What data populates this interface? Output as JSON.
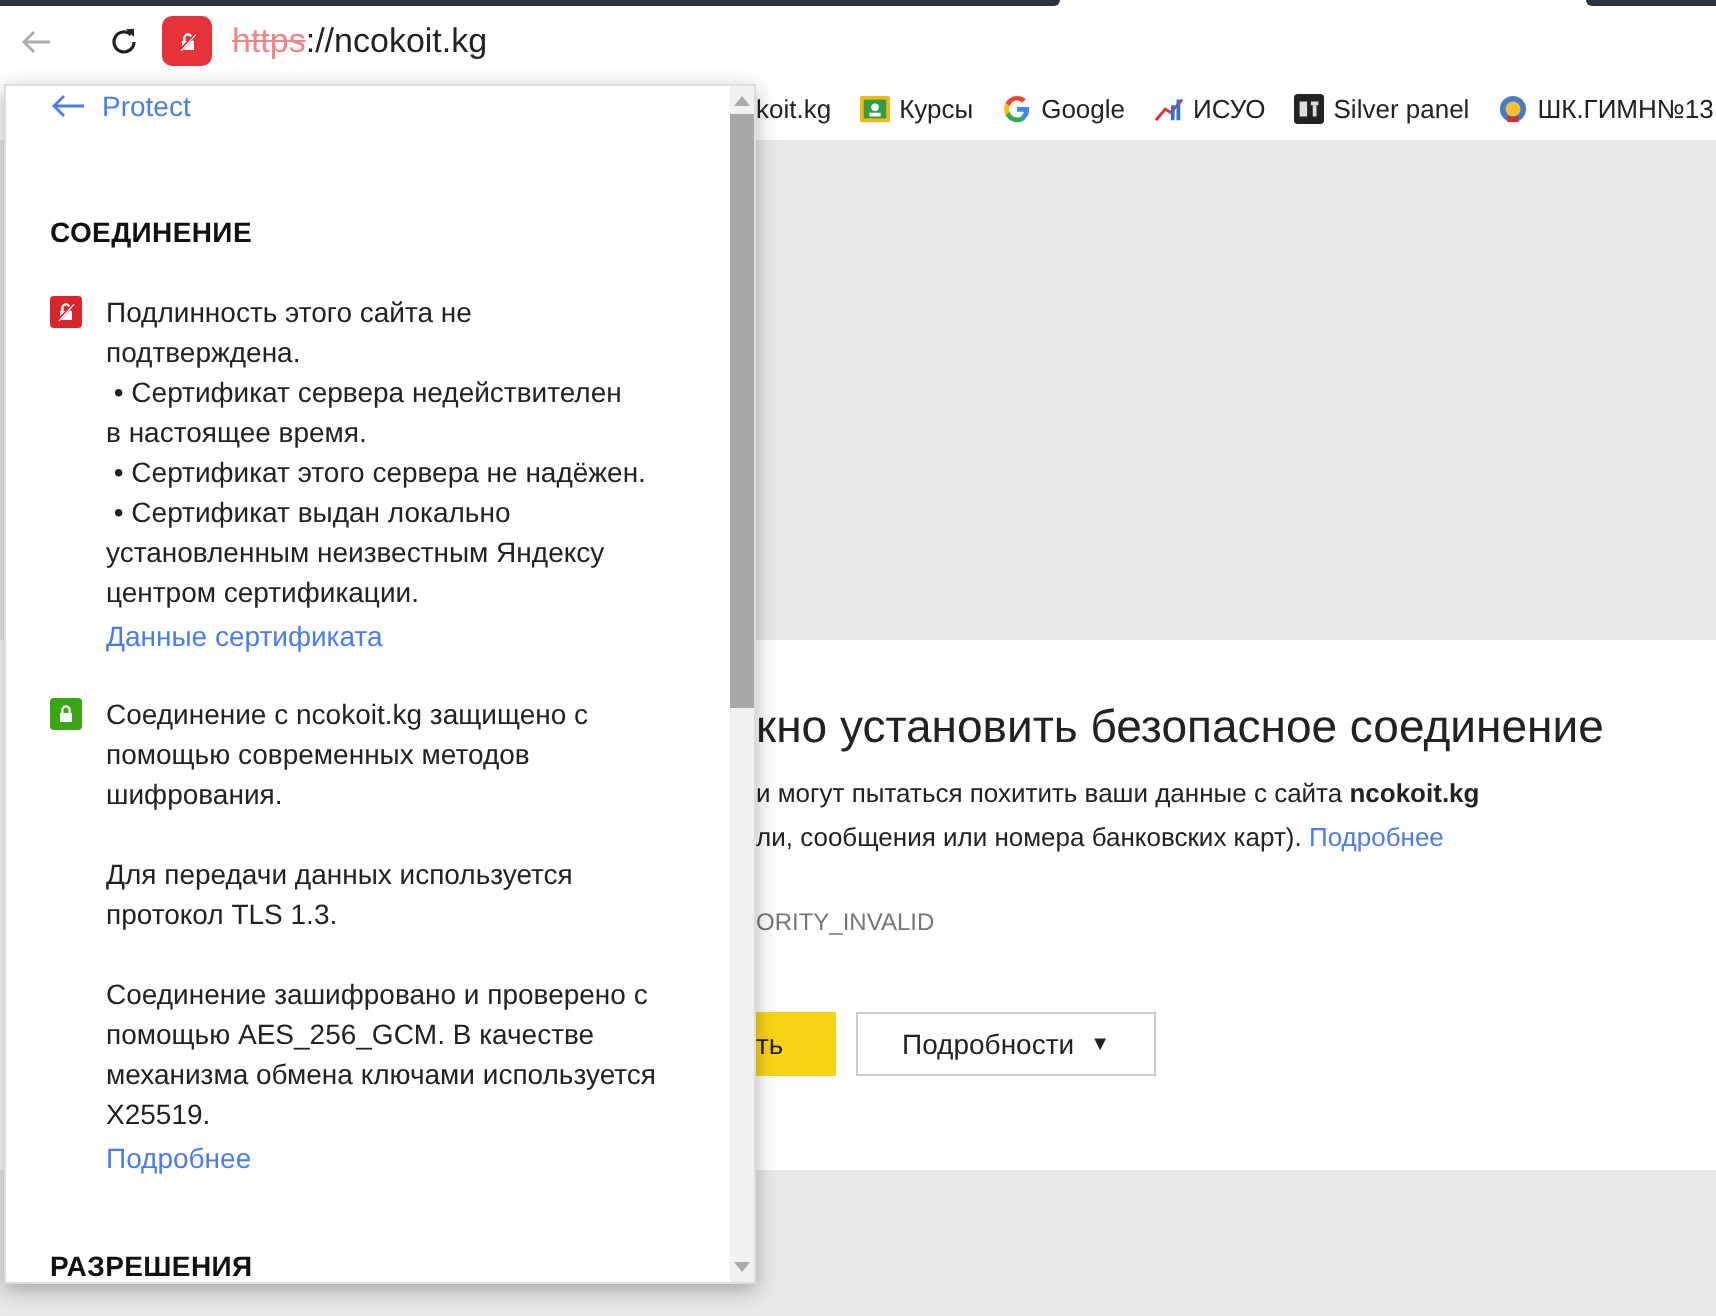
{
  "toolbar": {
    "address": {
      "scheme": "https",
      "rest": "://ncokoit.kg",
      "insecure": true
    }
  },
  "bookmarks": [
    {
      "label": "koit.kg"
    },
    {
      "label": "Курсы"
    },
    {
      "label": "Google"
    },
    {
      "label": "ИСУО"
    },
    {
      "label": "Silver panel"
    },
    {
      "label": "ШК.ГИМН№13"
    }
  ],
  "error_page": {
    "heading": "кно установить безопасное соединение",
    "line_1": "и могут пытаться похитить ваши данные с сайта **ncokoit.kg**",
    "line_2": "ли, сообщения или номера банковских карт).",
    "line_2_link": "Подробнее",
    "error_code": "ORITY_INVALID",
    "primary_button": "ть",
    "details_button": "Подробности",
    "details_caret": "▼"
  },
  "popup": {
    "back_label": "Protect",
    "sections": [
      {
        "title": "СОЕДИНЕНИЕ",
        "items": [
          {
            "secure": false,
            "paragraphs": [
              "Подлинность этого сайта не\nподтверждена.\n • Сертификат сервера недействителен\nв настоящее время.\n • Сертификат этого сервера не надёжен.\n • Сертификат выдан локально\nустановленным неизвестным Яндексу\nцентром сертификации."
            ],
            "link": "Данные сертификата"
          },
          {
            "secure": true,
            "paragraphs": [
              "Соединение с ncokoit.kg защищено с\nпомощью современных методов\nшифрования.",
              "Для передачи данных используется\nпротокол TLS 1.3.",
              "Соединение зашифровано и проверено с\nпомощью AES_256_GCM. В качестве\nмеханизма обмена ключами используется\nX25519."
            ],
            "link": "Подробнее"
          }
        ]
      },
      {
        "title": "РАЗРЕШЕНИЯ"
      }
    ]
  }
}
